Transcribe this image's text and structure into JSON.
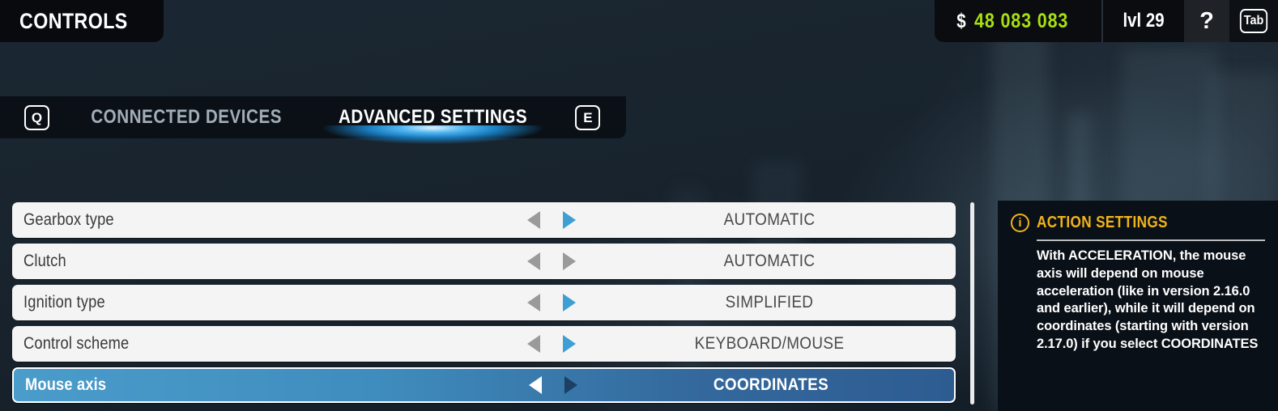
{
  "header": {
    "title": "CONTROLS",
    "hud": {
      "currency_symbol": "$",
      "money": "48 083 083",
      "level": "lvl 29",
      "help_label": "?",
      "tab_key": "Tab"
    }
  },
  "tabbar": {
    "prev_key": "Q",
    "next_key": "E",
    "tabs": [
      {
        "label": "CONNECTED DEVICES",
        "active": false
      },
      {
        "label": "ADVANCED SETTINGS",
        "active": true
      }
    ]
  },
  "settings": {
    "rows": [
      {
        "label": "Gearbox type",
        "value": "AUTOMATIC",
        "left_arrow": "gray",
        "right_arrow": "blue",
        "selected": false
      },
      {
        "label": "Clutch",
        "value": "AUTOMATIC",
        "left_arrow": "gray",
        "right_arrow": "gray",
        "selected": false
      },
      {
        "label": "Ignition type",
        "value": "SIMPLIFIED",
        "left_arrow": "gray",
        "right_arrow": "blue",
        "selected": false
      },
      {
        "label": "Control scheme",
        "value": "KEYBOARD/MOUSE",
        "left_arrow": "gray",
        "right_arrow": "blue",
        "selected": false
      },
      {
        "label": "Mouse axis",
        "value": "COORDINATES",
        "left_arrow": "white",
        "right_arrow": "dark",
        "selected": true
      }
    ]
  },
  "info_panel": {
    "icon": "info-circle",
    "title": "ACTION SETTINGS",
    "body": "With ACCELERATION, the mouse axis will depend on mouse acceleration (like in version 2.16.0 and earlier), while it will depend on coordinates (starting with version 2.17.0) if you select COORDINATES"
  },
  "colors": {
    "accent_blue": "#3f9fd4",
    "money_green": "#a8e010",
    "info_amber": "#f0b419",
    "row_bg": "#f4f4f4",
    "panel_bg": "#0a1017"
  }
}
